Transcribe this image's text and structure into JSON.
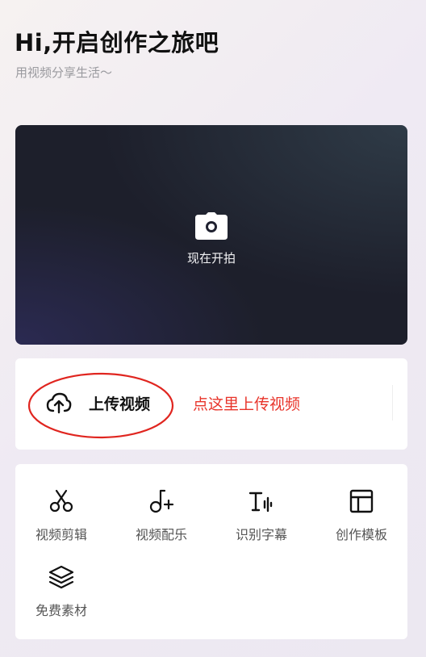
{
  "header": {
    "title": "Hi,开启创作之旅吧",
    "subtitle": "用视频分享生活～"
  },
  "camera_card": {
    "icon": "camera-icon",
    "label": "现在开拍"
  },
  "upload": {
    "icon": "cloud-upload-icon",
    "label": "上传视频",
    "hint": "点这里上传视频",
    "hint_color": "#e8342a",
    "annotation_color": "#e0251f"
  },
  "tools": [
    {
      "icon": "scissors-icon",
      "label": "视频剪辑"
    },
    {
      "icon": "music-add-icon",
      "label": "视频配乐"
    },
    {
      "icon": "text-recognition-icon",
      "label": "识别字幕"
    },
    {
      "icon": "template-icon",
      "label": "创作模板"
    },
    {
      "icon": "layers-icon",
      "label": "免费素材"
    }
  ]
}
